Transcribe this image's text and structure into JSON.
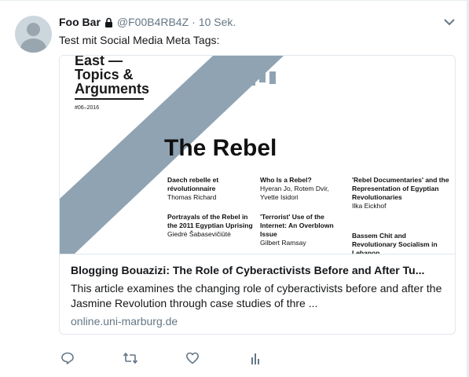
{
  "tweet": {
    "name": "Foo Bar",
    "handle": "@F00B4RB4Z",
    "separator": "·",
    "time": "10 Sek.",
    "text": "Test mit Social Media Meta Tags:"
  },
  "card": {
    "image": {
      "series": [
        "East —",
        "Topics &",
        "Arguments"
      ],
      "issue": "#06–2016",
      "title": "The Rebel",
      "toc": [
        {
          "title": "Daech rebelle et révolutionnaire",
          "author": "Thomas Richard"
        },
        {
          "title": "Who Is a Rebel?",
          "author": "Hyeran Jo, Rotem Dvir, Yvette Isidori"
        },
        {
          "title": "'Rebel Documentaries' and the Representation of Egyptian Revolutionaries",
          "author": "Ilka Eickhof"
        },
        {
          "title": "Portrayals of the Rebel in the 2011 Egyptian Uprising",
          "author": "Giedrė Šabasevičiūtė"
        },
        {
          "title": "'Terrorist' Use of the Internet: An Overblown Issue",
          "author": "Gilbert Ramsay"
        },
        {
          "title": "Bassem Chit and Revolutionary Socialism in Lebanon",
          "author": ""
        }
      ]
    },
    "title": "Blogging Bouazizi: The Role of Cyberactivists Before and After Tu...",
    "description": "This article examines the changing role of cyberactivists before and after the Jasmine Revolution through case studies of thre ...",
    "domain": "online.uni-marburg.de"
  },
  "icons": {
    "lock": "lock-icon",
    "caret": "chevron-down-icon",
    "reply": "reply-icon",
    "retweet": "retweet-icon",
    "like": "heart-icon",
    "analytics": "analytics-icon"
  },
  "colors": {
    "accent_gray": "#657786",
    "stripe": "#8fa3b3",
    "text": "#14171a"
  }
}
